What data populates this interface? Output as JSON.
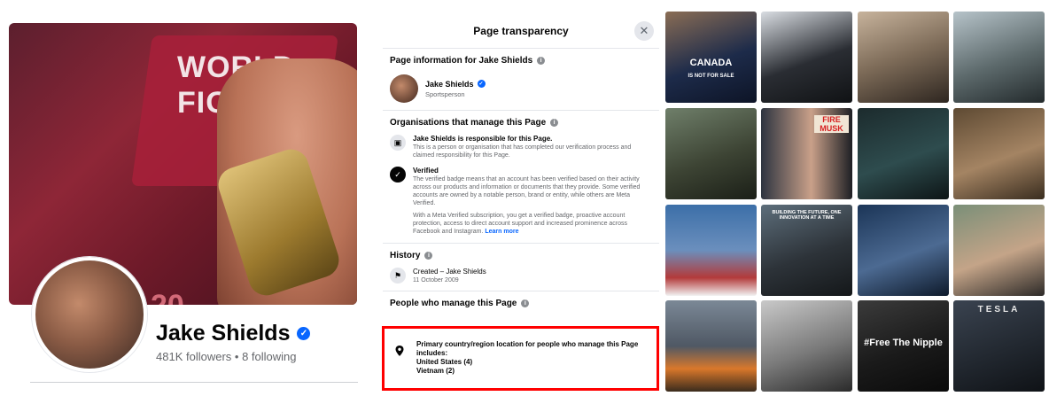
{
  "profile": {
    "name": "Jake Shields",
    "followers": "481K followers",
    "separator": " • ",
    "following": "8 following",
    "cover_text_1": "WORLD",
    "cover_text_2": "FIGH",
    "cover_number": "20"
  },
  "dialog": {
    "title": "Page transparency",
    "page_info_title": "Page information for Jake Shields",
    "page_name": "Jake Shields",
    "page_category": "Sportsperson",
    "orgs_title": "Organisations that manage this Page",
    "responsible_title": "Jake Shields is responsible for this Page.",
    "responsible_text": "This is a person or organisation that has completed our verification process and claimed responsibility for this Page.",
    "verified_title": "Verified",
    "verified_text": "The verified badge means that an account has been verified based on their activity across our products and information or documents that they provide. Some verified accounts are owned by a notable person, brand or entity, while others are Meta Verified.",
    "meta_verified_text": "With a Meta Verified subscription, you get a verified badge, proactive account protection, access to direct account support and increased prominence across Facebook and Instagram.",
    "learn_more": "Learn more",
    "history_title": "History",
    "created_label": "Created – Jake Shields",
    "created_date": "11 October 2009",
    "people_title": "People who manage this Page",
    "location_heading": "Primary country/region location for people who manage this Page includes:",
    "locations": [
      "United States (4)",
      "Vietnam (2)"
    ]
  },
  "grid": {
    "captions": {
      "canada": "CANADA",
      "not_for_sale": "IS NOT FOR SALE",
      "fire_musk": "FIRE MUSK",
      "building_future": "BUILDING THE FUTURE, ONE INNOVATION AT A TIME",
      "free_nipple": "#Free The Nipple",
      "tesla": "TESLA"
    }
  },
  "colors": {
    "accent": "#0866ff",
    "highlight_border": "#ff0000",
    "secondary_text": "#65676b"
  }
}
